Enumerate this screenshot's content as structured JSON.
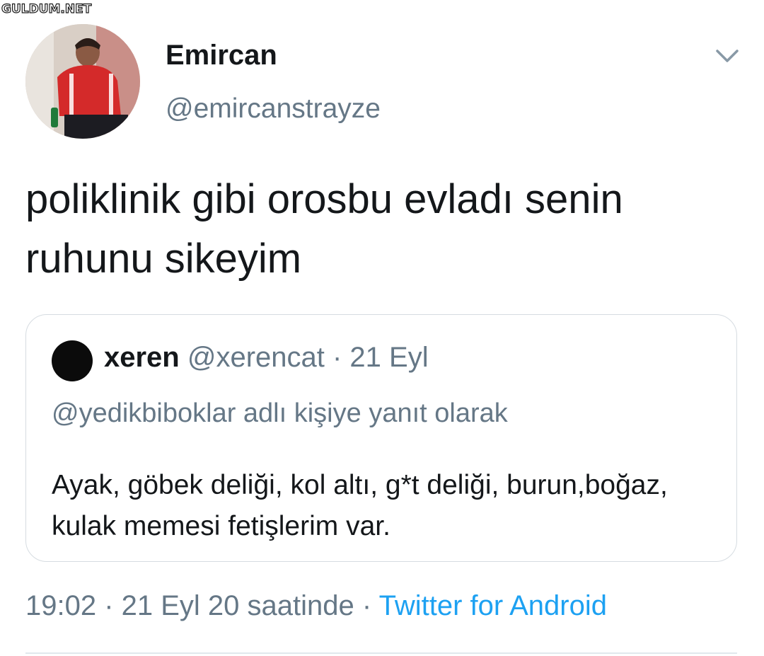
{
  "watermark": "GULDUM.NET",
  "tweet": {
    "display_name": "Emircan",
    "handle": "@emircanstrayze",
    "text": "poliklinik gibi orosbu evladı senin ruhunu sikeyim",
    "time_prefix": "19:02 · 21 Eyl 20 saatinde · ",
    "source": "Twitter for Android"
  },
  "quoted": {
    "name": "xeren",
    "meta": " @xerencat · 21 Eyl",
    "reply_to": "@yedikbiboklar adlı kişiye yanıt olarak",
    "text": "Ayak, göbek deliği, kol altı, g*t deliği, burun,boğaz, kulak memesi fetişlerim var."
  },
  "icons": {
    "menu": "chevron-down-icon",
    "link_color": "#1da1f2",
    "secondary_color": "#657786"
  }
}
